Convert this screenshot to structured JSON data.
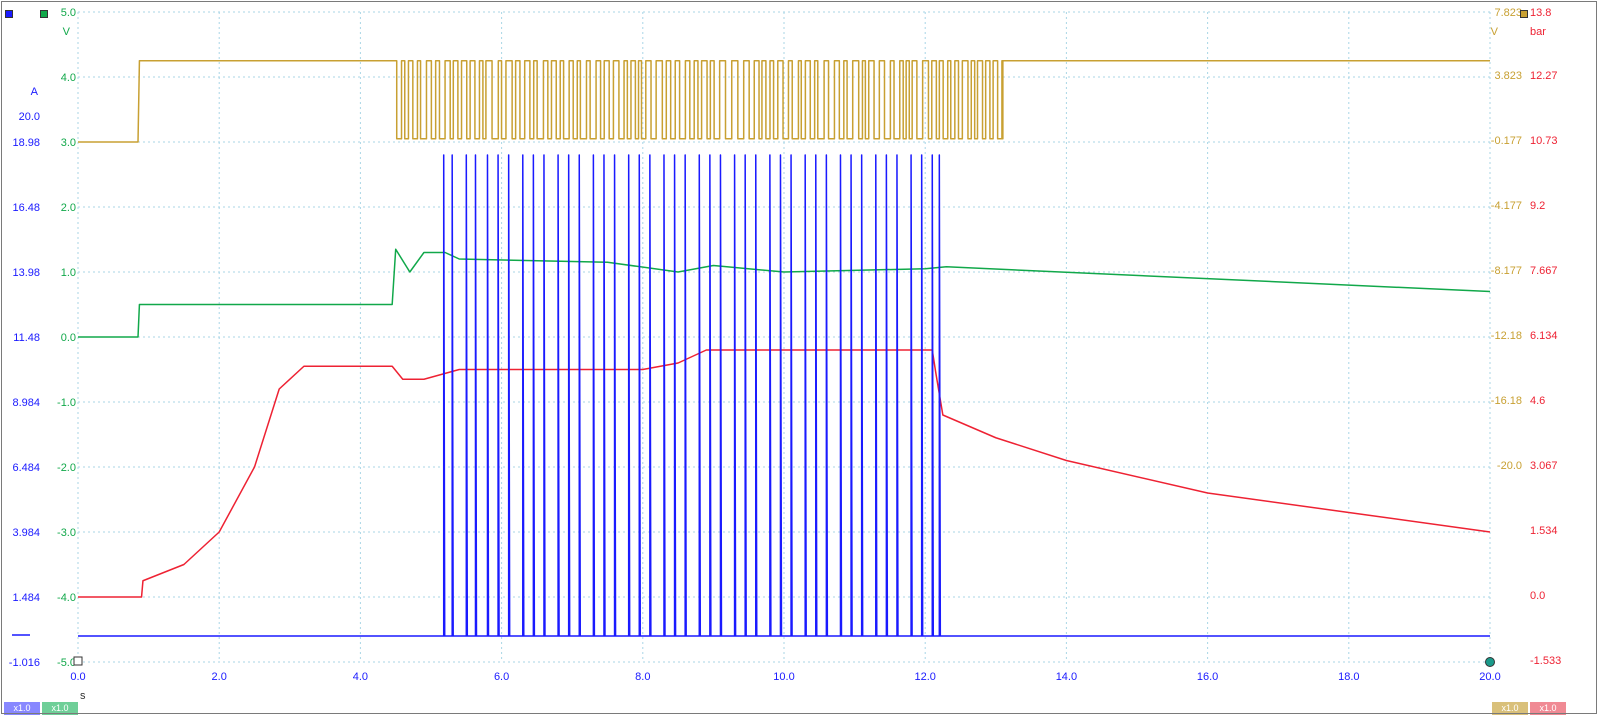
{
  "chart_data": {
    "type": "line",
    "x_axis": {
      "unit": "s",
      "range": [
        0,
        20
      ],
      "ticks": [
        "0.0",
        "2.0",
        "4.0",
        "6.0",
        "8.0",
        "10.0",
        "12.0",
        "14.0",
        "16.0",
        "18.0",
        "20.0"
      ]
    },
    "axes": {
      "green_left": {
        "unit": "V",
        "ticks": [
          "5.0",
          "4.0",
          "3.0",
          "2.0",
          "1.0",
          "0.0",
          "-1.0",
          "-2.0",
          "-3.0",
          "-4.0",
          "-5.0"
        ],
        "color": "#11a84a"
      },
      "blue_left": {
        "unit": "A",
        "ticks": [
          "20.0",
          "18.98",
          "16.48",
          "13.98",
          "11.48",
          "8.984",
          "6.484",
          "3.984",
          "1.484",
          "-1.016"
        ],
        "color": "#1a1aff"
      },
      "yellow_right": {
        "unit": "V",
        "ticks": [
          "7.823",
          "3.823",
          "-0.177",
          "-4.177",
          "-8.177",
          "-12.18",
          "-16.18",
          "-20.0"
        ],
        "color": "#c8a032"
      },
      "red_right": {
        "unit": "bar",
        "ticks": [
          "13.8",
          "12.27",
          "10.73",
          "9.2",
          "7.667",
          "6.134",
          "4.6",
          "3.067",
          "1.534",
          "0.0",
          "-1.533"
        ],
        "color": "#ee2233"
      }
    },
    "series": [
      {
        "color": "#c8a032",
        "points": [
          [
            0,
            3.0
          ],
          [
            0.85,
            3.0
          ],
          [
            0.87,
            4.25
          ],
          [
            4.45,
            4.25
          ],
          [
            13.1,
            4.25
          ],
          [
            20,
            4.25
          ]
        ],
        "pulsing": {
          "from": 4.45,
          "to": 13.1,
          "low": 3.05,
          "high": 4.25
        }
      },
      {
        "color": "#11a84a",
        "points": [
          [
            0,
            0.0
          ],
          [
            0.85,
            0.0
          ],
          [
            0.87,
            0.5
          ],
          [
            4.45,
            0.5
          ],
          [
            4.5,
            1.35
          ],
          [
            4.7,
            1.0
          ],
          [
            4.9,
            1.3
          ],
          [
            5.2,
            1.3
          ],
          [
            5.4,
            1.2
          ],
          [
            7.5,
            1.15
          ],
          [
            8.5,
            1.0
          ],
          [
            9.0,
            1.1
          ],
          [
            10.0,
            1.0
          ],
          [
            12.0,
            1.05
          ],
          [
            12.3,
            1.08
          ],
          [
            20,
            0.7
          ]
        ]
      },
      {
        "color": "#ee2233",
        "points": [
          [
            0,
            -4.0
          ],
          [
            0.9,
            -4.0
          ],
          [
            0.92,
            -3.75
          ],
          [
            1.5,
            -3.5
          ],
          [
            2.0,
            -3.0
          ],
          [
            2.5,
            -2.0
          ],
          [
            2.85,
            -0.8
          ],
          [
            3.2,
            -0.45
          ],
          [
            4.45,
            -0.45
          ],
          [
            4.6,
            -0.65
          ],
          [
            4.9,
            -0.65
          ],
          [
            5.4,
            -0.5
          ],
          [
            8.0,
            -0.5
          ],
          [
            8.5,
            -0.4
          ],
          [
            8.9,
            -0.2
          ],
          [
            12.1,
            -0.2
          ],
          [
            12.15,
            -0.55
          ],
          [
            12.25,
            -1.2
          ],
          [
            13.0,
            -1.55
          ],
          [
            14,
            -1.9
          ],
          [
            16,
            -2.4
          ],
          [
            18,
            -2.7
          ],
          [
            20,
            -3.0
          ]
        ]
      },
      {
        "color": "#1a1aff",
        "baseline": -4.6,
        "points": [
          [
            0,
            -4.6
          ],
          [
            20,
            -4.6
          ]
        ],
        "spikes": [
          5.18,
          5.3,
          5.5,
          5.63,
          5.8,
          5.95,
          6.1,
          6.3,
          6.45,
          6.6,
          6.8,
          6.95,
          7.1,
          7.3,
          7.45,
          7.6,
          7.8,
          7.95,
          8.1,
          8.3,
          8.45,
          8.6,
          8.8,
          8.95,
          9.1,
          9.3,
          9.45,
          9.6,
          9.8,
          9.95,
          10.1,
          10.3,
          10.45,
          10.6,
          10.8,
          10.95,
          11.1,
          11.3,
          11.45,
          11.6,
          11.8,
          11.95,
          12.1,
          12.2
        ],
        "spike_top": 2.8
      }
    ]
  },
  "ui": {
    "scale_left_blue": "x1.0",
    "scale_left_green": "x1.0",
    "scale_right_yellow": "x1.0",
    "scale_right_red": "x1.0"
  }
}
